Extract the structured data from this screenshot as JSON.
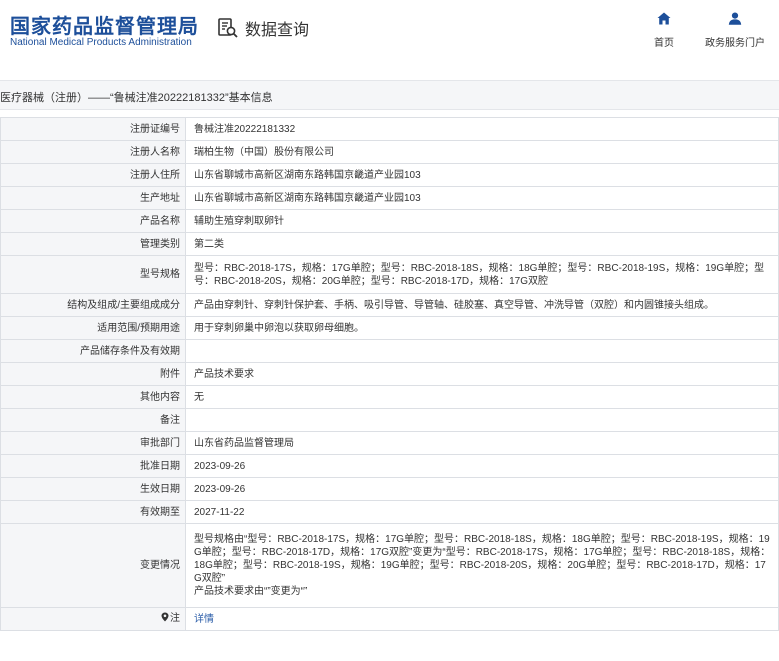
{
  "header": {
    "logo_cn": "国家药品监督管理局",
    "logo_en": "National Medical Products Administration",
    "section_title": "数据查询",
    "nav": {
      "home_label": "首页",
      "gov_label": "政务服务门户"
    }
  },
  "titlebar": {
    "text": "医疗器械（注册）——“鲁械注准20222181332”基本信息"
  },
  "icons": {
    "section": "document-search-icon",
    "home": "home-icon",
    "gov": "user-icon",
    "note": "pin-icon"
  },
  "colors": {
    "brand": "#1d4f9a",
    "link": "#2a5ca8",
    "label_bg": "#f5f6f8",
    "border": "#dcdfe4"
  },
  "rows": [
    {
      "label": "注册证编号",
      "value": "鲁械注准20222181332"
    },
    {
      "label": "注册人名称",
      "value": "瑞柏生物（中国）股份有限公司"
    },
    {
      "label": "注册人住所",
      "value": "山东省聊城市高新区湖南东路韩国京畿道产业园103"
    },
    {
      "label": "生产地址",
      "value": "山东省聊城市高新区湖南东路韩国京畿道产业园103"
    },
    {
      "label": "产品名称",
      "value": "辅助生殖穿刺取卵针"
    },
    {
      "label": "管理类别",
      "value": "第二类"
    },
    {
      "label": "型号规格",
      "value": "型号：RBC-2018-17S，规格：17G单腔；型号：RBC-2018-18S，规格：18G单腔；型号：RBC-2018-19S，规格：19G单腔；型号：RBC-2018-20S，规格：20G单腔；型号：RBC-2018-17D，规格：17G双腔"
    },
    {
      "label": "结构及组成/主要组成成分",
      "value": "产品由穿刺针、穿刺针保护套、手柄、吸引导管、导管轴、硅胶塞、真空导管、冲洗导管（双腔）和内圆锥接头组成。"
    },
    {
      "label": "适用范围/预期用途",
      "value": "用于穿刺卵巢中卵泡以获取卵母细胞。"
    },
    {
      "label": "产品储存条件及有效期",
      "value": ""
    },
    {
      "label": "附件",
      "value": "产品技术要求"
    },
    {
      "label": "其他内容",
      "value": "无"
    },
    {
      "label": "备注",
      "value": ""
    },
    {
      "label": "审批部门",
      "value": "山东省药品监督管理局"
    },
    {
      "label": "批准日期",
      "value": "2023-09-26"
    },
    {
      "label": "生效日期",
      "value": "2023-09-26"
    },
    {
      "label": "有效期至",
      "value": "2027-11-22"
    }
  ],
  "change_row": {
    "label": "变更情况",
    "line1": "型号规格由“型号：RBC-2018-17S，规格：17G单腔；型号：RBC-2018-18S，规格：18G单腔；型号：RBC-2018-19S，规格：19G单腔；型号：RBC-2018-17D，规格：17G双腔”变更为“型号：RBC-2018-17S，规格：17G单腔；型号：RBC-2018-18S，规格：18G单腔；型号：RBC-2018-19S，规格：19G单腔；型号：RBC-2018-20S，规格：20G单腔；型号：RBC-2018-17D，规格：17G双腔”",
    "line2": "产品技术要求由“”变更为“”"
  },
  "note_row": {
    "label": "注",
    "link": "详情"
  }
}
